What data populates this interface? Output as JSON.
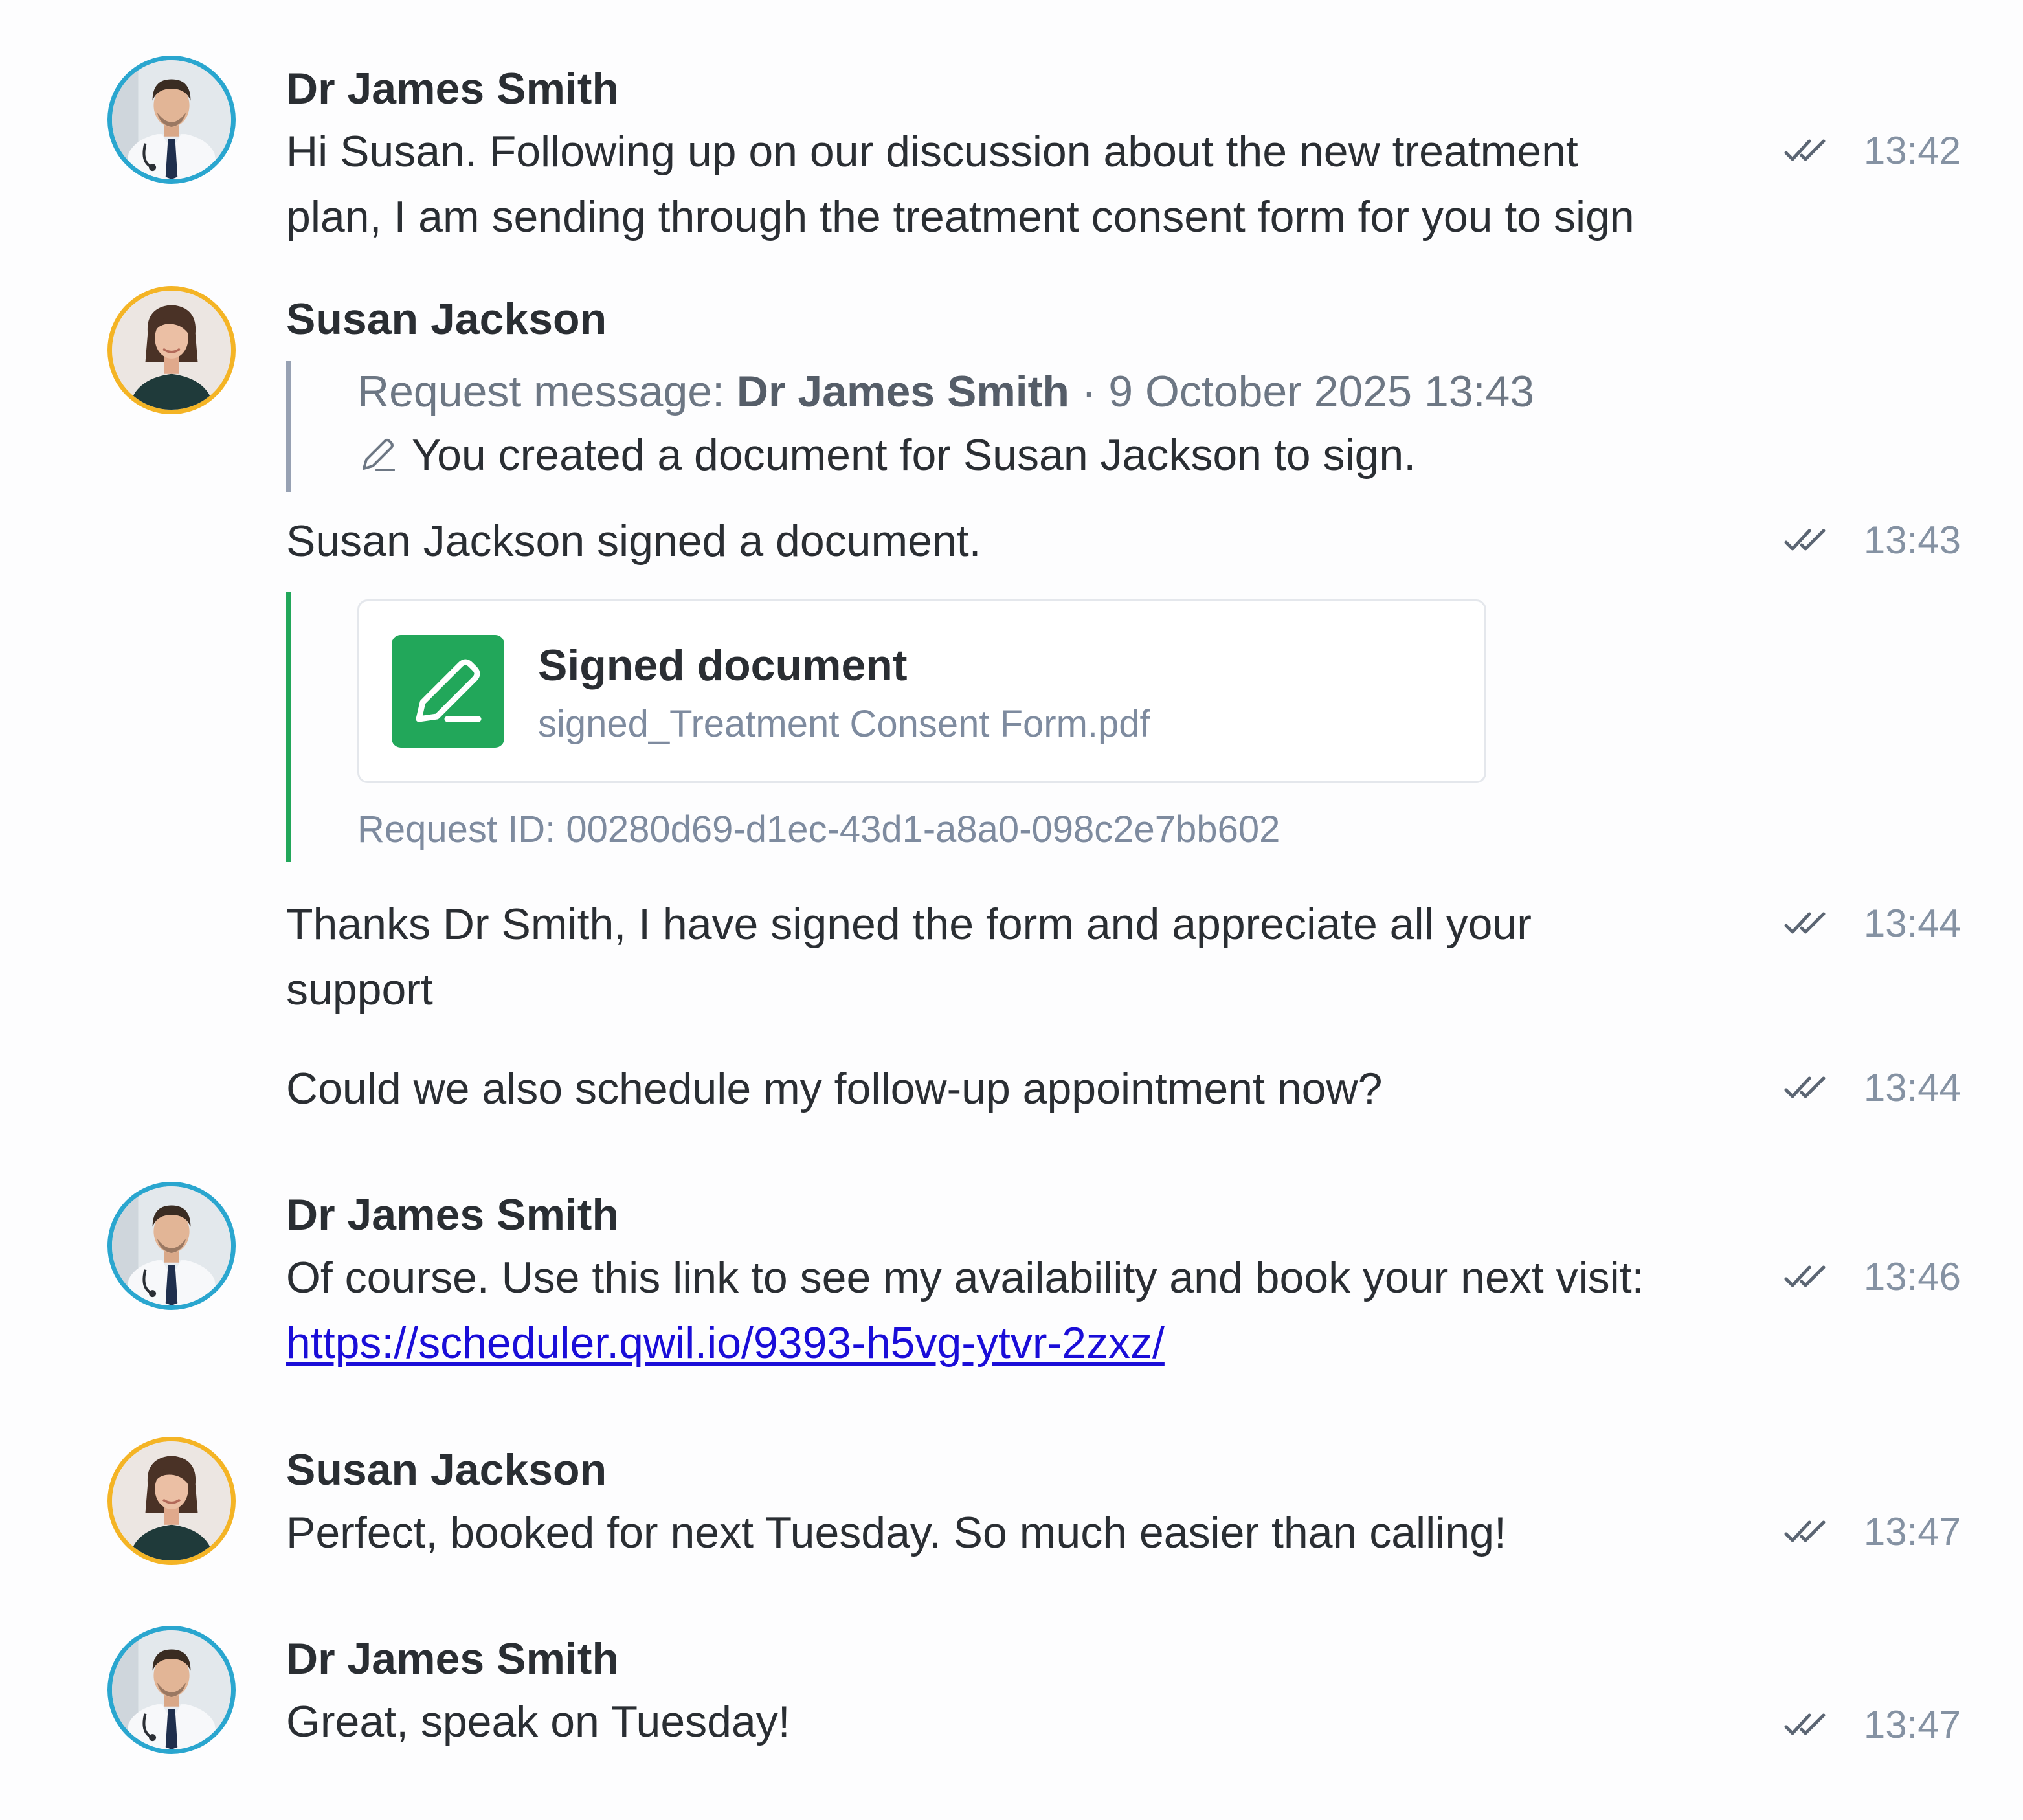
{
  "colors": {
    "doctor_ring": "#2aa6cf",
    "patient_ring": "#f4b425",
    "signed_green": "#22a75a",
    "link_blue": "#1a0dd8",
    "meta_gray": "#8592a3"
  },
  "icons": {
    "read_receipt": "double-check-icon",
    "pen": "pen-icon",
    "doctor_avatar": "doctor-avatar",
    "patient_avatar": "patient-avatar"
  },
  "messages": [
    {
      "sender": "Dr James Smith",
      "lines": [
        "Hi Susan. Following up on our discussion about the new treatment",
        "plan, I am sending through the treatment consent form for you to sign"
      ],
      "time": "13:42"
    },
    {
      "sender": "Susan Jackson",
      "quote": {
        "prefix": "Request message: ",
        "author": "Dr James Smith",
        "separator": " · ",
        "datetime": "9 October 2025 13:43",
        "body": "You created a document for Susan Jackson to sign."
      },
      "text": "Susan Jackson signed a document.",
      "time": "13:43",
      "document": {
        "title": "Signed document",
        "filename": "signed_Treatment Consent Form.pdf",
        "request_id": "Request ID: 00280d69-d1ec-43d1-a8a0-098c2e7bb602"
      }
    },
    {
      "lines": [
        "Thanks Dr Smith, I have signed the form and appreciate all your",
        "support"
      ],
      "time": "13:44"
    },
    {
      "text": "Could we also schedule my follow-up appointment now?",
      "time": "13:44"
    },
    {
      "sender": "Dr James Smith",
      "text": "Of course. Use this link to see my availability and book your next visit:",
      "link": "https://scheduler.qwil.io/9393-h5vg-ytvr-2zxz/",
      "time": "13:46"
    },
    {
      "sender": "Susan Jackson",
      "text": "Perfect, booked for next Tuesday. So much easier than calling!",
      "time": "13:47"
    },
    {
      "sender": "Dr James Smith",
      "text": "Great, speak on Tuesday!",
      "time": "13:47"
    }
  ]
}
